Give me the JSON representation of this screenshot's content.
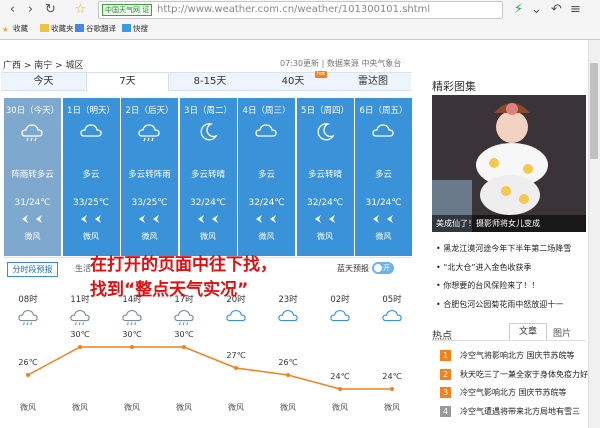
{
  "browser": {
    "url_badge": "中国天气网",
    "url_badge_suffix": "证",
    "url": "http://www.weather.com.cn/weather/101300101.shtml",
    "bookmarks": [
      "收藏",
      "收藏夹",
      "谷歌翻译",
      "快搜"
    ]
  },
  "page": {
    "breadcrumb": "广西 > 南宁 > 城区",
    "updated": "07:30更新 | 数据来源 中央气象台",
    "tabs": [
      "今天",
      "7天",
      "8-15天",
      "40天",
      "雷达图"
    ],
    "active_tab": "7天",
    "hot_badge": "hot"
  },
  "days": [
    {
      "date": "30日（今天）",
      "desc": "阵雨转多云",
      "temp": "31/24℃",
      "level": "微风",
      "icon": "shower-cloud-icon"
    },
    {
      "date": "1日（明天）",
      "desc": "多云",
      "temp": "33/25℃",
      "level": "微风",
      "icon": "cloud-icon"
    },
    {
      "date": "2日（后天）",
      "desc": "多云转阵雨",
      "temp": "33/25℃",
      "level": "微风",
      "icon": "cloud-rain-icon"
    },
    {
      "date": "3日（周二）",
      "desc": "多云转晴",
      "temp": "32/24℃",
      "level": "微风",
      "icon": "moon-icon"
    },
    {
      "date": "4日（周三）",
      "desc": "多云",
      "temp": "32/24℃",
      "level": "微风",
      "icon": "cloud-icon"
    },
    {
      "date": "5日（周四）",
      "desc": "多云转晴",
      "temp": "32/24℃",
      "level": "微风",
      "icon": "moon-icon"
    },
    {
      "date": "6日（周五）",
      "desc": "多云",
      "temp": "31/24℃",
      "level": "微风",
      "icon": "cloud-icon"
    }
  ],
  "hourly": {
    "tab_hourly": "分时段预报",
    "tab_life": "生活",
    "radar_label": "蓝天预报",
    "toggle": "开",
    "hours": [
      "08时",
      "11时",
      "14时",
      "17时",
      "20时",
      "23时",
      "02时",
      "05时"
    ],
    "temps": [
      "26℃",
      "30℃",
      "30℃",
      "30℃",
      "27℃",
      "26℃",
      "24℃",
      "24℃"
    ],
    "temp_values": [
      26,
      30,
      30,
      30,
      27,
      26,
      24,
      24
    ],
    "winds": [
      "微风",
      "微风",
      "微风",
      "微风",
      "微风",
      "微风",
      "微风",
      "微风"
    ],
    "icons": [
      "shower-icon",
      "shower-icon",
      "shower-icon",
      "shower-icon",
      "cloud-icon",
      "cloud-icon",
      "cloud-icon",
      "cloud-icon"
    ]
  },
  "overlay": {
    "line1": "在打开的页面中往下找，",
    "line2": "找到“整点天气实况”"
  },
  "right": {
    "gallery_title": "精彩图集",
    "photo_caption": "美成仙了！摄影师将女儿变成",
    "news": [
      "黑龙江漠河途今年下半年第二场降雪",
      "“北大仓”进入金色收获季",
      "你想要的台风保险来了！！",
      "合肥包河公园菊花雨中怒放迎十一"
    ],
    "hot_title": "热点",
    "hot_tabs": [
      "文章",
      "图片"
    ],
    "hot_list": [
      "冷空气将影响北方 国庆节苏皖等",
      "秋天吃三了一兼全家于身体免疫力好",
      "冷空气影响北方 国庆节苏皖等",
      "冷空气遭遇将带来北方局地有雪三"
    ],
    "rank_colors": [
      "#f2811d",
      "#f2811d",
      "#f2811d",
      "#999999"
    ]
  }
}
